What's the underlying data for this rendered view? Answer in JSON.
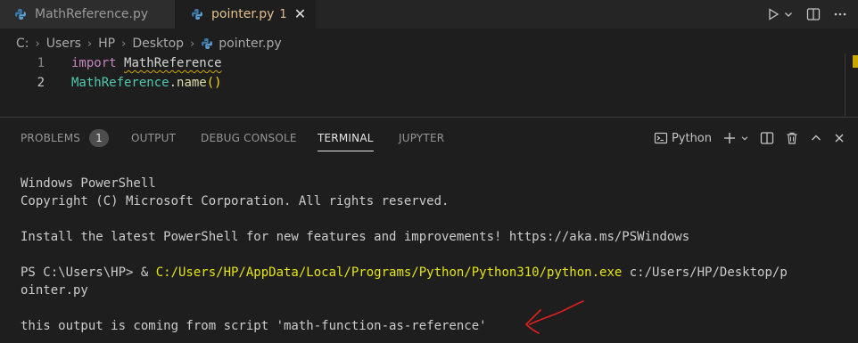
{
  "tabs": [
    {
      "label": "MathReference.py",
      "active": false
    },
    {
      "label": "pointer.py",
      "active": true,
      "badge": "1"
    }
  ],
  "breadcrumb": {
    "segments": [
      "C:",
      "Users",
      "HP",
      "Desktop"
    ],
    "file": "pointer.py"
  },
  "editor": {
    "lines": [
      {
        "number": "1",
        "keyword": "import",
        "module": "MathReference"
      },
      {
        "number": "2",
        "module": "MathReference",
        "dot": ".",
        "function": "name",
        "parens": "()"
      }
    ]
  },
  "panel": {
    "tabs": {
      "problems": "PROBLEMS",
      "problems_count": "1",
      "output": "OUTPUT",
      "debug_console": "DEBUG CONSOLE",
      "terminal": "TERMINAL",
      "jupyter": "JUPYTER"
    },
    "active_tab": "TERMINAL",
    "terminal_profile": "Python"
  },
  "terminal": {
    "line1": "Windows PowerShell",
    "line2": "Copyright (C) Microsoft Corporation. All rights reserved.",
    "line3": "Install the latest PowerShell for new features and improvements! https://aka.ms/PSWindows",
    "prompt": "PS C:\\Users\\HP> & ",
    "exe_path": "C:/Users/HP/AppData/Local/Programs/Python/Python310/python.exe",
    "arg": " c:/Users/HP/Desktop/p",
    "arg_wrap": "ointer.py",
    "output": "this output is coming from script 'math-function-as-reference'"
  },
  "colors": {
    "keyword": "#c586c0",
    "module": "#4ec9b0",
    "function": "#dcdcaa",
    "bracket": "#ffd700",
    "modified_tab": "#e2c08d",
    "exe_path": "#e5e510",
    "annotation": "#e02020"
  },
  "icons": [
    "python-file-icon",
    "run-icon",
    "chevron-down-icon",
    "split-editor-icon",
    "more-actions-icon",
    "terminal-icon",
    "add-icon",
    "trash-icon",
    "chevron-up-icon",
    "close-icon"
  ]
}
